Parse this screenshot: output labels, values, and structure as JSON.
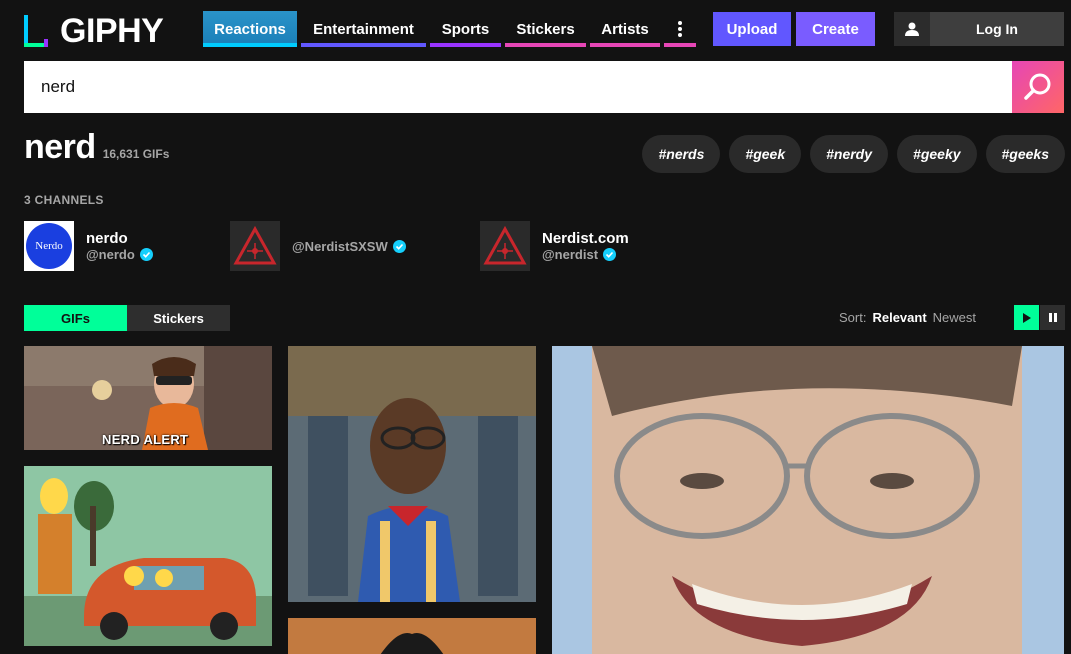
{
  "header": {
    "logo_text": "GIPHY",
    "nav": [
      {
        "label": "Reactions",
        "color": "#00ccff",
        "active": true
      },
      {
        "label": "Entertainment",
        "color": "#6157ff"
      },
      {
        "label": "Sports",
        "color": "#9933ff"
      },
      {
        "label": "Stickers",
        "color": "#e646b6"
      },
      {
        "label": "Artists",
        "color": "#e646b6"
      }
    ],
    "more_icon": "more-vertical-icon",
    "upload_label": "Upload",
    "create_label": "Create",
    "login_label": "Log In"
  },
  "search": {
    "value": "nerd",
    "button_icon": "search-icon"
  },
  "results": {
    "title": "nerd",
    "count": "16,631 GIFs",
    "tags": [
      "#nerds",
      "#geek",
      "#nerdy",
      "#geeky",
      "#geeks"
    ]
  },
  "channels": {
    "heading": "3 CHANNELS",
    "items": [
      {
        "name": "nerdo",
        "handle": "@nerdo",
        "avatar_text": "Nerdo",
        "verified": true
      },
      {
        "name": "",
        "handle": "@NerdistSXSW",
        "verified": true
      },
      {
        "name": "Nerdist.com",
        "handle": "@nerdist",
        "verified": true
      }
    ]
  },
  "filters": {
    "tabs": [
      "GIFs",
      "Stickers"
    ],
    "active_tab": "GIFs",
    "sort_label": "Sort:",
    "sort_options": [
      "Relevant",
      "Newest"
    ],
    "sort_selected": "Relevant"
  },
  "gifs": [
    {
      "caption": "NERD ALERT"
    }
  ],
  "colors": {
    "background": "#121212",
    "accent_green": "#00ff99",
    "accent_purple": "#6157ff",
    "accent_blue": "#00ccff",
    "verified": "#15cffc"
  }
}
